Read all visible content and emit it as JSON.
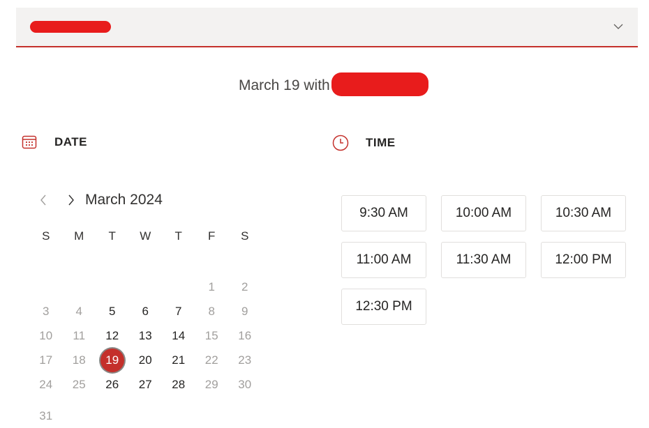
{
  "select": {
    "value_redacted": true
  },
  "heading": {
    "text": "March 19 with"
  },
  "date_section": {
    "label": "DATE"
  },
  "time_section": {
    "label": "TIME"
  },
  "calendar": {
    "month_label": "March 2024",
    "weekdays": [
      "S",
      "M",
      "T",
      "W",
      "T",
      "F",
      "S"
    ],
    "weeks": [
      [
        null,
        null,
        null,
        null,
        null,
        {
          "d": "1",
          "s": "muted"
        },
        {
          "d": "2",
          "s": "muted"
        }
      ],
      [
        {
          "d": "3",
          "s": "muted"
        },
        {
          "d": "4",
          "s": "muted"
        },
        {
          "d": "5",
          "s": "avail"
        },
        {
          "d": "6",
          "s": "avail"
        },
        {
          "d": "7",
          "s": "avail"
        },
        {
          "d": "8",
          "s": "muted"
        },
        {
          "d": "9",
          "s": "muted"
        }
      ],
      [
        {
          "d": "10",
          "s": "muted"
        },
        {
          "d": "11",
          "s": "muted"
        },
        {
          "d": "12",
          "s": "avail"
        },
        {
          "d": "13",
          "s": "avail"
        },
        {
          "d": "14",
          "s": "avail"
        },
        {
          "d": "15",
          "s": "muted"
        },
        {
          "d": "16",
          "s": "muted"
        }
      ],
      [
        {
          "d": "17",
          "s": "muted"
        },
        {
          "d": "18",
          "s": "muted"
        },
        {
          "d": "19",
          "s": "selected"
        },
        {
          "d": "20",
          "s": "avail"
        },
        {
          "d": "21",
          "s": "avail"
        },
        {
          "d": "22",
          "s": "muted"
        },
        {
          "d": "23",
          "s": "muted"
        }
      ],
      [
        {
          "d": "24",
          "s": "muted"
        },
        {
          "d": "25",
          "s": "muted"
        },
        {
          "d": "26",
          "s": "avail"
        },
        {
          "d": "27",
          "s": "avail"
        },
        {
          "d": "28",
          "s": "avail"
        },
        {
          "d": "29",
          "s": "muted"
        },
        {
          "d": "30",
          "s": "muted"
        }
      ],
      [
        {
          "d": "31",
          "s": "muted"
        },
        null,
        null,
        null,
        null,
        null,
        null
      ]
    ]
  },
  "time_slots": [
    "9:30 AM",
    "10:00 AM",
    "10:30 AM",
    "11:00 AM",
    "11:30 AM",
    "12:00 PM",
    "12:30 PM"
  ],
  "colors": {
    "accent": "#c4302b",
    "redaction": "#e81c1c",
    "muted_text": "#a19f9d"
  }
}
